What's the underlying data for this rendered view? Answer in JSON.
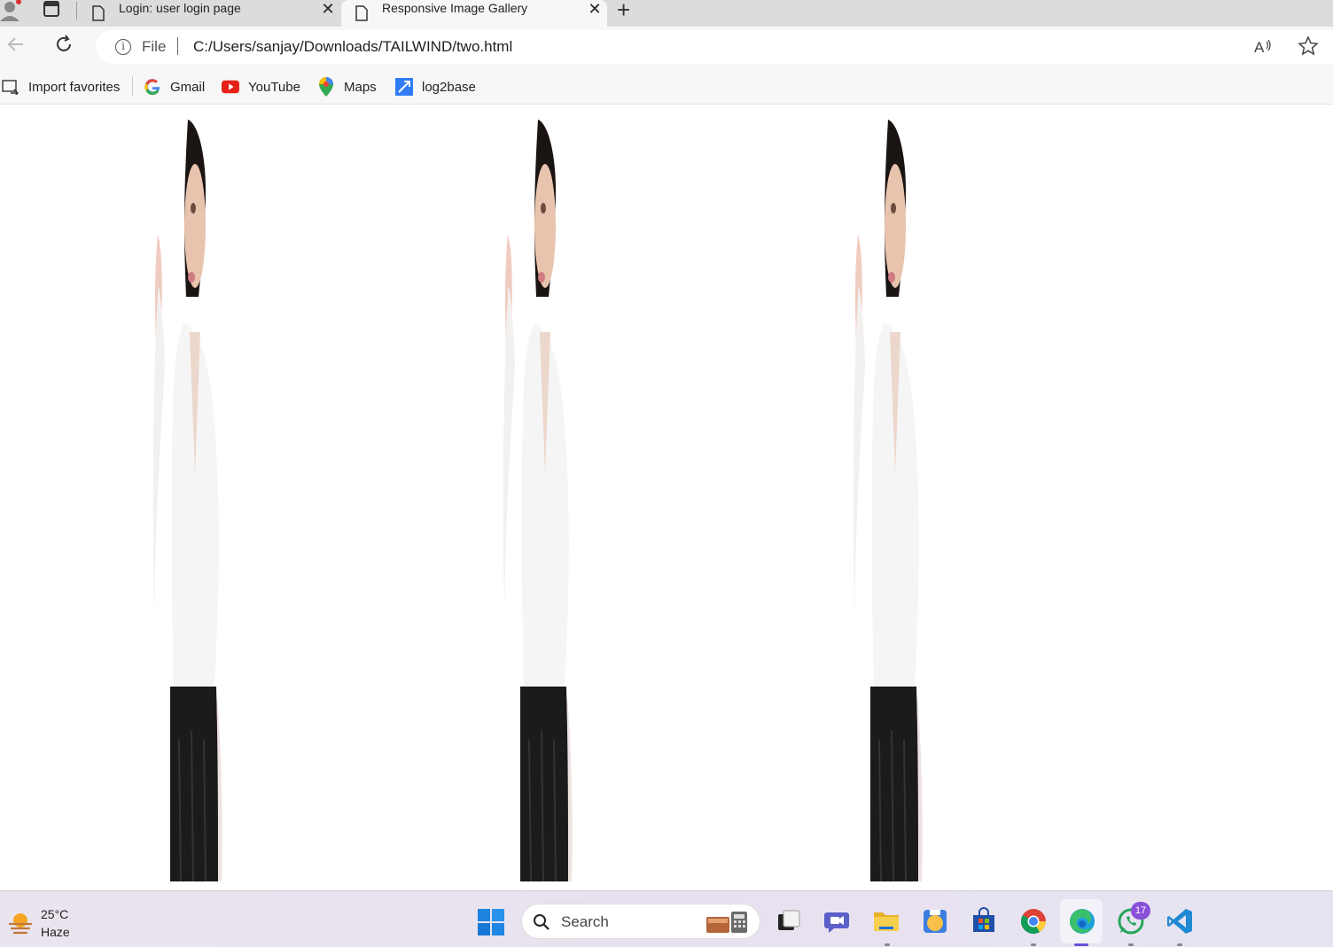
{
  "browser": {
    "tabs": [
      {
        "title": "Login: user login page",
        "active": false
      },
      {
        "title": "Responsive Image Gallery",
        "active": true
      }
    ],
    "address": {
      "scheme_label": "File",
      "url": "C:/Users/sanjay/Downloads/TAILWIND/two.html"
    },
    "favorites": [
      {
        "label": "Import favorites",
        "icon": "import-icon"
      },
      {
        "label": "Gmail",
        "icon": "google-icon"
      },
      {
        "label": "YouTube",
        "icon": "youtube-icon"
      },
      {
        "label": "Maps",
        "icon": "maps-icon"
      },
      {
        "label": "log2base",
        "icon": "log2base-icon"
      }
    ],
    "read_aloud_label": "A̅"
  },
  "gallery": {
    "image_count": 3,
    "image_description": "woman-in-white-shirt"
  },
  "taskbar": {
    "weather": {
      "temp": "25°C",
      "condition": "Haze"
    },
    "search_label": "Search",
    "whatsapp_badge": "17",
    "apps": [
      "start-icon",
      "task-view-icon",
      "teams-chat-icon",
      "file-explorer-icon",
      "photos-icon",
      "store-icon",
      "chrome-icon",
      "edge-icon",
      "whatsapp-icon",
      "vscode-icon"
    ]
  },
  "colors": {
    "tabstrip": "#dcdcdc",
    "toolbar": "#f7f7f7",
    "taskbar": "#eae4ee",
    "badge": "#8a4fd8"
  }
}
